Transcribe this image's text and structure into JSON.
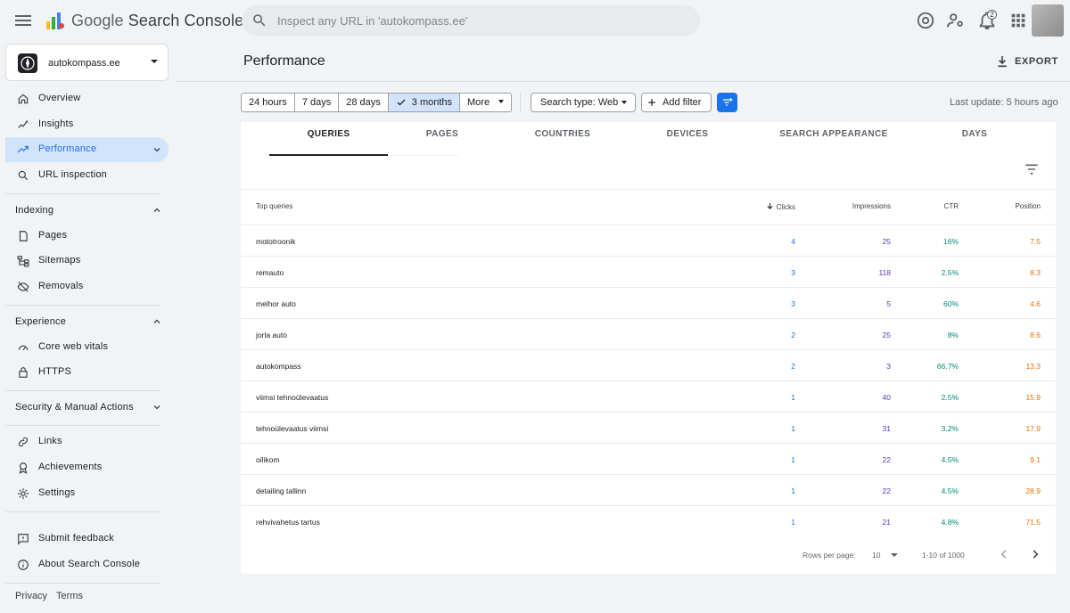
{
  "header": {
    "product_brand": "Google",
    "product_name": "Search Console",
    "search_placeholder": "Inspect any URL in 'autokompass.ee'",
    "notification_count": "2"
  },
  "sidebar": {
    "property": "autokompass.ee",
    "top_items": [
      {
        "label": "Overview",
        "icon": "home-icon"
      },
      {
        "label": "Insights",
        "icon": "insights-icon"
      },
      {
        "label": "Performance",
        "icon": "trending-up-icon",
        "active": true
      },
      {
        "label": "URL inspection",
        "icon": "search-icon"
      }
    ],
    "indexing": {
      "title": "Indexing",
      "items": [
        {
          "label": "Pages",
          "icon": "pages-icon"
        },
        {
          "label": "Sitemaps",
          "icon": "sitemap-icon"
        },
        {
          "label": "Removals",
          "icon": "visibility-off-icon"
        }
      ]
    },
    "experience": {
      "title": "Experience",
      "items": [
        {
          "label": "Core web vitals",
          "icon": "speed-icon"
        },
        {
          "label": "HTTPS",
          "icon": "lock-icon"
        }
      ]
    },
    "security": {
      "title": "Security & Manual Actions"
    },
    "bottom_items": [
      {
        "label": "Links",
        "icon": "link-icon"
      },
      {
        "label": "Achievements",
        "icon": "achievement-icon"
      },
      {
        "label": "Settings",
        "icon": "gear-icon"
      }
    ],
    "support_items": [
      {
        "label": "Submit feedback",
        "icon": "feedback-icon"
      },
      {
        "label": "About Search Console",
        "icon": "info-icon"
      }
    ],
    "footer": {
      "privacy": "Privacy",
      "terms": "Terms"
    }
  },
  "main": {
    "title": "Performance",
    "export_label": "EXPORT",
    "date_ranges": [
      "24 hours",
      "7 days",
      "28 days",
      "3 months",
      "More"
    ],
    "selected_range": "3 months",
    "search_type": "Search type: Web",
    "add_filter": "Add filter",
    "last_update": "Last update: 5 hours ago",
    "tabs": [
      "QUERIES",
      "PAGES",
      "COUNTRIES",
      "DEVICES",
      "SEARCH APPEARANCE",
      "DAYS"
    ],
    "active_tab": "QUERIES",
    "table": {
      "headers": {
        "query": "Top queries",
        "clicks": "Clicks",
        "impressions": "Impressions",
        "ctr": "CTR",
        "position": "Position"
      },
      "rows": [
        {
          "query": "mototroonik",
          "clicks": "4",
          "impressions": "25",
          "ctr": "16%",
          "position": "7.5"
        },
        {
          "query": "remauto",
          "clicks": "3",
          "impressions": "118",
          "ctr": "2.5%",
          "position": "8.3"
        },
        {
          "query": "melhor auto",
          "clicks": "3",
          "impressions": "5",
          "ctr": "60%",
          "position": "4.6"
        },
        {
          "query": "jorla auto",
          "clicks": "2",
          "impressions": "25",
          "ctr": "8%",
          "position": "8.6"
        },
        {
          "query": "autokompass",
          "clicks": "2",
          "impressions": "3",
          "ctr": "66.7%",
          "position": "13.3"
        },
        {
          "query": "viimsi tehnoülevaatus",
          "clicks": "1",
          "impressions": "40",
          "ctr": "2.5%",
          "position": "15.9"
        },
        {
          "query": "tehnoülevaatus viimsi",
          "clicks": "1",
          "impressions": "31",
          "ctr": "3.2%",
          "position": "17.9"
        },
        {
          "query": "oilikom",
          "clicks": "1",
          "impressions": "22",
          "ctr": "4.5%",
          "position": "9.1"
        },
        {
          "query": "detailing tallinn",
          "clicks": "1",
          "impressions": "22",
          "ctr": "4.5%",
          "position": "28.9"
        },
        {
          "query": "rehvivahetus tartus",
          "clicks": "1",
          "impressions": "21",
          "ctr": "4.8%",
          "position": "71.5"
        }
      ]
    },
    "pagination": {
      "rows_per_page_label": "Rows per page:",
      "rows_per_page": "10",
      "range": "1-10 of 1000"
    }
  },
  "colors": {
    "accent": "#1a73e8",
    "clicks": "#1a73e8",
    "impressions": "#5e35b1",
    "ctr": "#00897b",
    "position": "#e8710a",
    "active_bg": "#d2e3fc"
  }
}
